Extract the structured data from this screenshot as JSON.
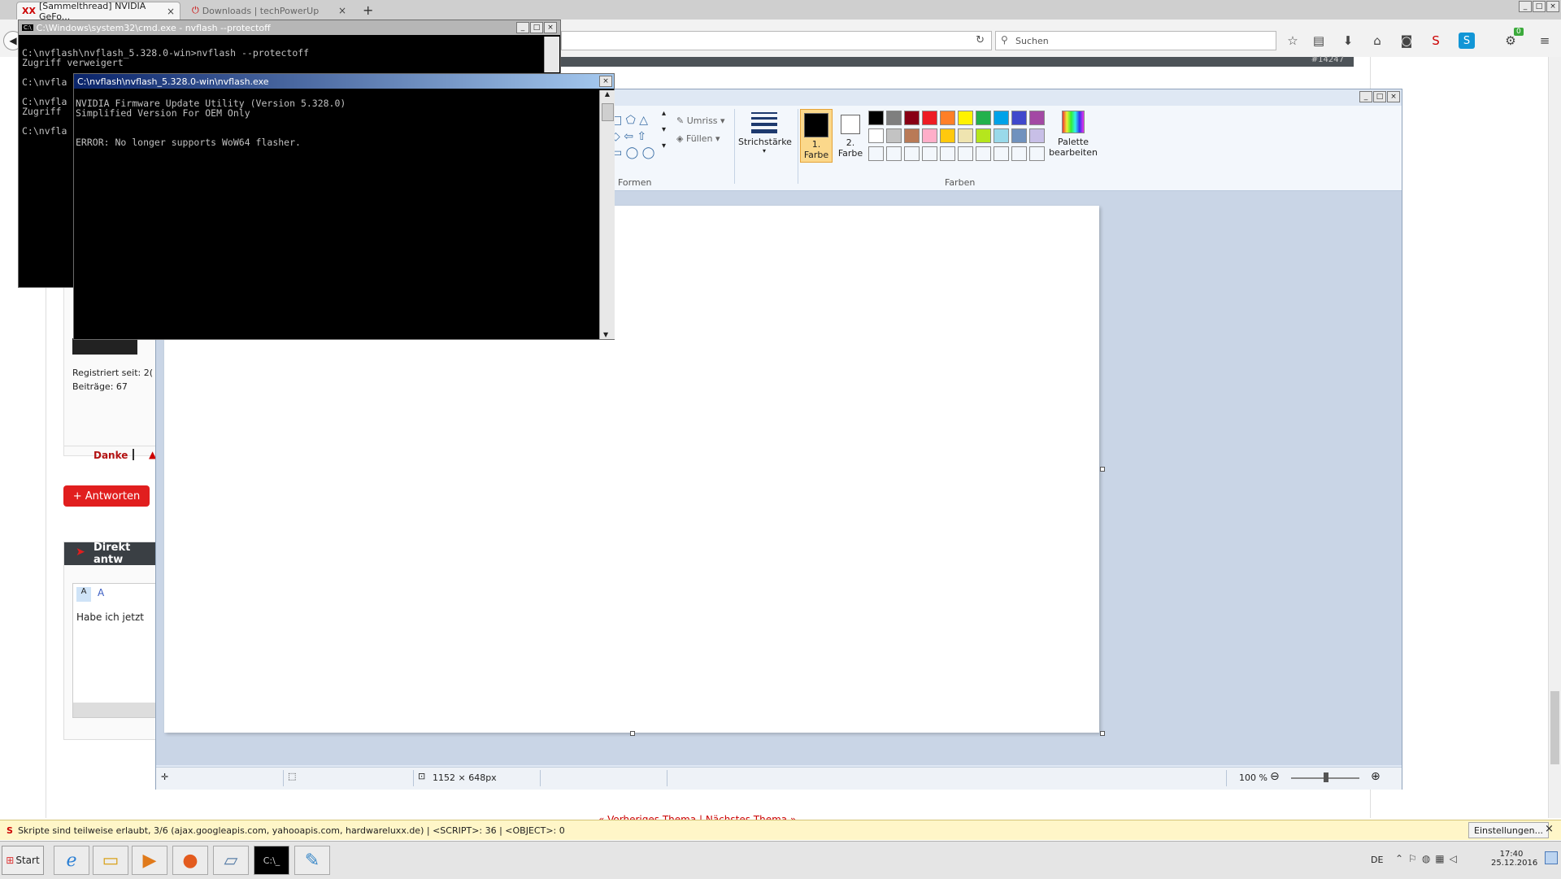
{
  "browser": {
    "tabs": [
      {
        "label": "[Sammelthread] NVIDIA GeFo...",
        "close": "×"
      },
      {
        "label": "Downloads | techPowerUp",
        "close": "×"
      }
    ],
    "new_tab": "+",
    "search_placeholder": "Suchen",
    "badge_count": "0",
    "window_controls": [
      "_",
      "□",
      "×"
    ]
  },
  "webpage": {
    "post_number": "#14247",
    "registered_label": "Registriert seit: 2(",
    "posts_label": "Beiträge: 67",
    "thanks_label": "Danke",
    "reply_button": "+ Antworten",
    "direct_reply_header": "Direkt antw",
    "editor_text": "Habe ich jetzt",
    "pagination": "« Vorheriges Thema | Nächstes Thema »"
  },
  "paint": {
    "shapes_group": "Formen",
    "outline_label": "Umriss",
    "fill_label": "Füllen",
    "stroke_label": "Strichstärke",
    "color1_line1": "1.",
    "color1_line2": "Farbe",
    "color2_line1": "2.",
    "color2_line2": "Farbe",
    "colors_group": "Farben",
    "palette_line1": "Palette",
    "palette_line2": "bearbeiten",
    "palette_colors": [
      "#000000",
      "#7f7f7f",
      "#880015",
      "#ed1c24",
      "#ff7f27",
      "#fff200",
      "#22b14c",
      "#00a2e8",
      "#3f48cc",
      "#a349a4",
      "#ffffff",
      "#c3c3c3",
      "#b97a57",
      "#ffaec9",
      "#ffc90e",
      "#efe4b0",
      "#b5e61d",
      "#99d9ea",
      "#7092be",
      "#c8bfe7"
    ],
    "image_size": "1152 × 648px",
    "zoom": "100 %"
  },
  "cmd_back": {
    "title": "C:\\Windows\\system32\\cmd.exe - nvflash  --protectoff",
    "lines": [
      "C:\\nvflash\\nvflash_5.328.0-win>nvflash --protectoff",
      "Zugriff verweigert",
      "",
      "C:\\nvfla",
      "",
      "C:\\nvfla",
      "Zugriff",
      "",
      "C:\\nvfla"
    ]
  },
  "cmd_front": {
    "title": "C:\\nvflash\\nvflash_5.328.0-win\\nvflash.exe",
    "lines": [
      "NVIDIA Firmware Update Utility (Version 5.328.0)",
      "Simplified Version For OEM Only",
      "",
      "",
      "ERROR: No longer supports WoW64 flasher."
    ]
  },
  "noscript": {
    "message": "Skripte sind teilweise erlaubt, 3/6 (ajax.googleapis.com, yahooapis.com, hardwareluxx.de) | <SCRIPT>: 36 | <OBJECT>: 0",
    "settings_button": "Einstellungen...",
    "close": "×"
  },
  "taskbar": {
    "start_label": "Start",
    "language": "DE",
    "time": "17:40",
    "date": "25.12.2016"
  }
}
